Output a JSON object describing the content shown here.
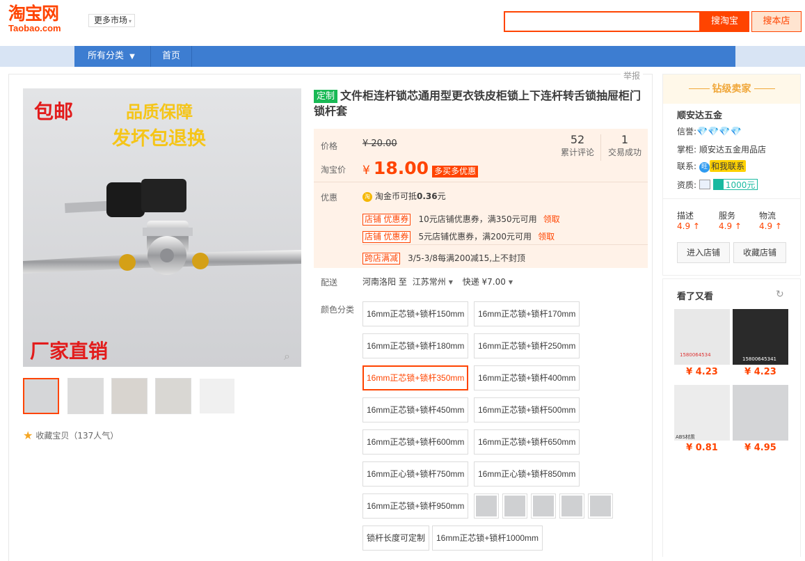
{
  "header": {
    "logo_cn": "淘宝网",
    "logo_en": "Taobao.com",
    "market_label": "更多市场",
    "search_placeholder": "",
    "search_tb_button": "搜淘宝",
    "search_store_button": "搜本店"
  },
  "nav": {
    "all_categories": "所有分类",
    "home": "首页"
  },
  "report_link": "举报",
  "gallery": {
    "main_text_1": "包邮",
    "main_text_2": "品质保障",
    "main_text_3": "发坏包退换",
    "main_text_4": "厂家直销",
    "thumb_count": 5,
    "favorite_label": "收藏宝贝（137人气）"
  },
  "product": {
    "custom_tag": "定制",
    "title": "文件柜连杆锁芯通用型更衣铁皮柜锁上下连杆转舌锁抽屉柜门锁杆套"
  },
  "price": {
    "price_label": "价格",
    "original_price": "¥ 20.00",
    "tb_price_label": "淘宝价",
    "currency": "¥",
    "current_price": "18.00",
    "pdd_badge": "多买多优惠",
    "reviews_count": "52",
    "reviews_label": "累计评论",
    "deals_count": "1",
    "deals_label": "交易成功"
  },
  "promo": {
    "label": "优惠",
    "coin_icon": "淘",
    "coin_text": "淘金币可抵",
    "coin_amount": "0.36",
    "coin_unit": "元",
    "coupons": [
      {
        "tag": "店铺 优惠券",
        "text": "10元店铺优惠券，满350元可用",
        "action": "领取"
      },
      {
        "tag": "店铺 优惠券",
        "text": "5元店铺优惠券，满200元可用",
        "action": "领取"
      }
    ],
    "cross_tag": "跨店满减",
    "cross_text": "3/5-3/8每满200减15,上不封顶"
  },
  "delivery": {
    "label": "配送",
    "from": "河南洛阳",
    "to_word": "至",
    "to": "江苏常州",
    "method": "快递 ¥7.00"
  },
  "sku": {
    "label": "颜色分类",
    "options": [
      "16mm正芯锁+锁杆150mm",
      "16mm正芯锁+锁杆170mm",
      "16mm正芯锁+锁杆180mm",
      "16mm正芯锁+锁杆250mm",
      "16mm正芯锁+锁杆350mm",
      "16mm正芯锁+锁杆400mm",
      "16mm正芯锁+锁杆450mm",
      "16mm正芯锁+锁杆500mm",
      "16mm正芯锁+锁杆600mm",
      "16mm正芯锁+锁杆650mm",
      "16mm正心锁+锁杆750mm",
      "16mm正心锁+锁杆850mm",
      "16mm正芯锁+锁杆950mm",
      "锁杆长度可定制",
      "16mm正芯锁+锁杆1000mm"
    ],
    "selected": "16mm正芯锁+锁杆350mm",
    "image_option_count": 5
  },
  "seller": {
    "level_title": "钻级卖家",
    "name": "顺安达五金",
    "credit_label": "信誉:",
    "diamonds": "💎💎💎💎",
    "manager_label": "掌柜:",
    "manager": "顺安达五金用品店",
    "contact_label": "联系:",
    "contact_icon": "旺",
    "contact_button": "和我联系",
    "qual_label": "资质:",
    "bond": "1000元",
    "scores": [
      {
        "label": "描述",
        "value": "4.9"
      },
      {
        "label": "服务",
        "value": "4.9"
      },
      {
        "label": "物流",
        "value": "4.9"
      }
    ],
    "enter_store": "进入店铺",
    "fav_store": "收藏店铺"
  },
  "recommend": {
    "title": "看了又看",
    "items": [
      {
        "price": "¥ 4.23",
        "caption": "1580064534"
      },
      {
        "price": "¥ 4.23",
        "caption": "15800645341"
      },
      {
        "price": "¥ 0.81",
        "caption": "ABS材质"
      },
      {
        "price": "¥ 4.95",
        "caption": ""
      }
    ]
  },
  "colors": {
    "accent": "#ff4400",
    "nav_blue": "#3d7dd1",
    "price_bg": "#fff2e8",
    "custom_green": "#19b955"
  }
}
